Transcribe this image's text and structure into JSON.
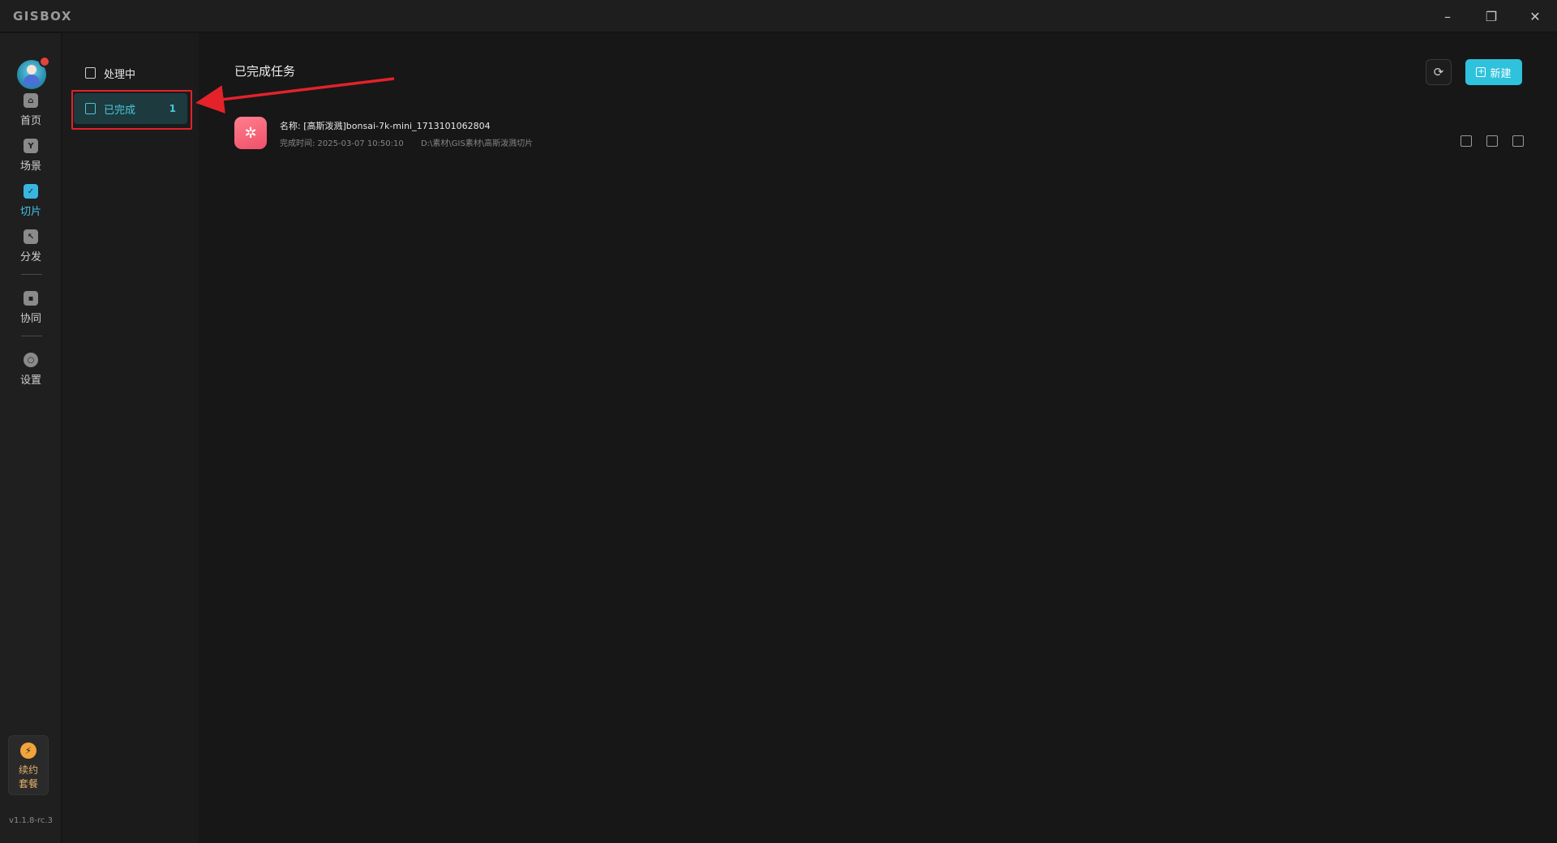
{
  "app": {
    "logo": "GISBOX"
  },
  "window_controls": {
    "minimize": "–",
    "restore": "❐",
    "close": "✕"
  },
  "rail": {
    "items": [
      {
        "label": "首页",
        "icon": "home-icon",
        "active": false
      },
      {
        "label": "场景",
        "icon": "scene-cube-icon",
        "active": false
      },
      {
        "label": "切片",
        "icon": "slice-doc-icon",
        "active": true
      },
      {
        "label": "分发",
        "icon": "distribute-icon",
        "active": false
      },
      {
        "label": "协同",
        "icon": "lock-icon",
        "active": false
      },
      {
        "label": "设置",
        "icon": "gear-icon",
        "active": false
      }
    ],
    "plan": {
      "label": "续约套餐",
      "icon": "lightning-icon"
    },
    "version": "v1.1.8-rc.3"
  },
  "subnav": {
    "items": [
      {
        "label": "处理中",
        "active": false,
        "count": ""
      },
      {
        "label": "已完成",
        "active": true,
        "count": "1"
      }
    ]
  },
  "main": {
    "title": "已完成任务",
    "new_button": "新建",
    "tasks": [
      {
        "name": "名称: [高斯泼溅]bonsai-7k-mini_1713101062804",
        "completed_time": "完成时间: 2025-03-07 10:50:10",
        "path": "D:\\素材\\GIS素材\\高斯泼溅切片"
      }
    ]
  },
  "colors": {
    "accent": "#2ec2dd",
    "annotation": "#e3222a",
    "task_icon": "#f0506a"
  }
}
